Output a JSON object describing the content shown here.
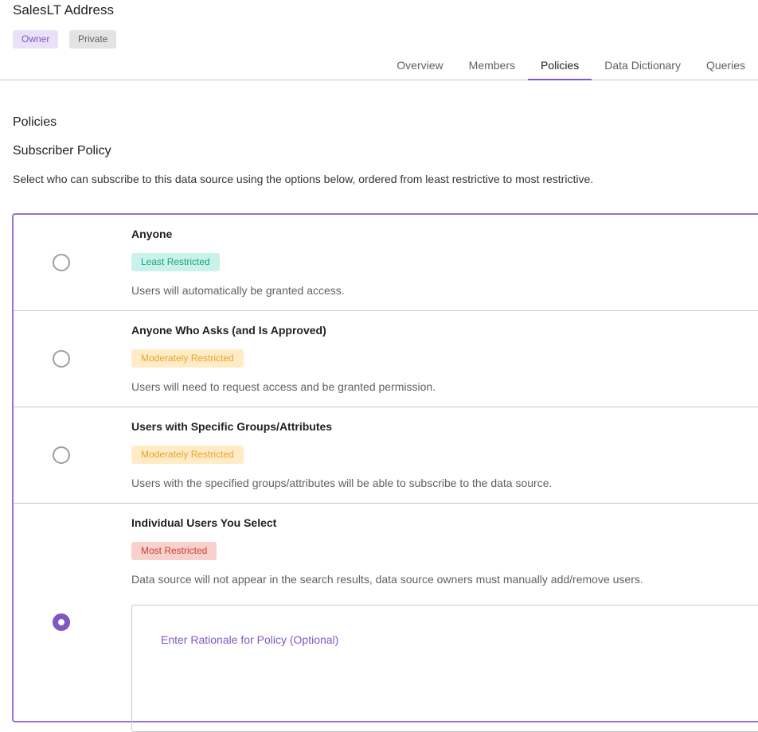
{
  "header": {
    "title": "SalesLT Address",
    "badges": [
      "Owner",
      "Private"
    ],
    "tabs": [
      "Overview",
      "Members",
      "Policies",
      "Data Dictionary",
      "Queries"
    ],
    "active_tab": "Policies"
  },
  "main": {
    "section_title": "Policies",
    "subsection_title": "Subscriber Policy",
    "description": "Select who can subscribe to this data source using the options below, ordered from least restrictive to most restrictive.",
    "options": [
      {
        "title": "Anyone",
        "badge": "Least Restricted",
        "desc": "Users will automatically be granted access.",
        "selected": false
      },
      {
        "title": "Anyone Who Asks (and Is Approved)",
        "badge": "Moderately Restricted",
        "desc": "Users will need to request access and be granted permission.",
        "selected": false
      },
      {
        "title": "Users with Specific Groups/Attributes",
        "badge": "Moderately Restricted",
        "desc": "Users with the specified groups/attributes will be able to subscribe to the data source.",
        "selected": false
      },
      {
        "title": "Individual Users You Select",
        "badge": "Most Restricted",
        "desc": "Data source will not appear in the search results, data source owners must manually add/remove users.",
        "selected": true
      }
    ],
    "rationale_label": "Enter Rationale for Policy (Optional)"
  },
  "colors": {
    "accent": "#7e57c2",
    "least": "#1aa189",
    "moderate": "#e9a22a",
    "most": "#c8412f"
  }
}
